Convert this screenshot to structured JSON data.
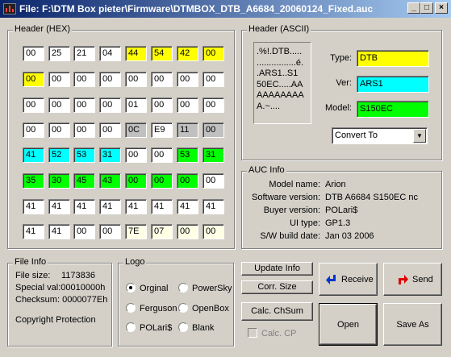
{
  "window": {
    "title": "File: F:\\DTM Box pieter\\Firmware\\DTMBOX_DTB_A6684_20060124_Fixed.auc",
    "minimize": "_",
    "maximize": "□",
    "close": "×"
  },
  "hex": {
    "title": "Header (HEX)",
    "rows": [
      [
        {
          "v": "00",
          "c": "w"
        },
        {
          "v": "25",
          "c": "w"
        },
        {
          "v": "21",
          "c": "w"
        },
        {
          "v": "04",
          "c": "w"
        },
        {
          "v": "44",
          "c": "y"
        },
        {
          "v": "54",
          "c": "y"
        },
        {
          "v": "42",
          "c": "y"
        },
        {
          "v": "00",
          "c": "y"
        }
      ],
      [
        {
          "v": "00",
          "c": "y"
        },
        {
          "v": "00",
          "c": "w"
        },
        {
          "v": "00",
          "c": "w"
        },
        {
          "v": "00",
          "c": "w"
        },
        {
          "v": "00",
          "c": "w"
        },
        {
          "v": "00",
          "c": "w"
        },
        {
          "v": "00",
          "c": "w"
        },
        {
          "v": "00",
          "c": "w"
        }
      ],
      [
        {
          "v": "00",
          "c": "w"
        },
        {
          "v": "00",
          "c": "w"
        },
        {
          "v": "00",
          "c": "w"
        },
        {
          "v": "00",
          "c": "w"
        },
        {
          "v": "01",
          "c": "w"
        },
        {
          "v": "00",
          "c": "w"
        },
        {
          "v": "00",
          "c": "w"
        },
        {
          "v": "00",
          "c": "w"
        }
      ],
      [
        {
          "v": "00",
          "c": "w"
        },
        {
          "v": "00",
          "c": "w"
        },
        {
          "v": "00",
          "c": "w"
        },
        {
          "v": "00",
          "c": "w"
        },
        {
          "v": "0C",
          "c": "s"
        },
        {
          "v": "E9",
          "c": "w"
        },
        {
          "v": "11",
          "c": "s"
        },
        {
          "v": "00",
          "c": "s"
        }
      ],
      [
        {
          "v": "41",
          "c": "c"
        },
        {
          "v": "52",
          "c": "c"
        },
        {
          "v": "53",
          "c": "c"
        },
        {
          "v": "31",
          "c": "c"
        },
        {
          "v": "00",
          "c": "w"
        },
        {
          "v": "00",
          "c": "w"
        },
        {
          "v": "53",
          "c": "g"
        },
        {
          "v": "31",
          "c": "g"
        }
      ],
      [
        {
          "v": "35",
          "c": "g"
        },
        {
          "v": "30",
          "c": "g"
        },
        {
          "v": "45",
          "c": "g"
        },
        {
          "v": "43",
          "c": "g"
        },
        {
          "v": "00",
          "c": "g"
        },
        {
          "v": "00",
          "c": "g"
        },
        {
          "v": "00",
          "c": "g"
        },
        {
          "v": "00",
          "c": "w"
        }
      ],
      [
        {
          "v": "41",
          "c": "w"
        },
        {
          "v": "41",
          "c": "w"
        },
        {
          "v": "41",
          "c": "w"
        },
        {
          "v": "41",
          "c": "w"
        },
        {
          "v": "41",
          "c": "w"
        },
        {
          "v": "41",
          "c": "w"
        },
        {
          "v": "41",
          "c": "w"
        },
        {
          "v": "41",
          "c": "w"
        }
      ],
      [
        {
          "v": "41",
          "c": "w"
        },
        {
          "v": "41",
          "c": "w"
        },
        {
          "v": "00",
          "c": "w"
        },
        {
          "v": "00",
          "c": "w"
        },
        {
          "v": "7E",
          "c": "l"
        },
        {
          "v": "07",
          "c": "l"
        },
        {
          "v": "00",
          "c": "l"
        },
        {
          "v": "00",
          "c": "l"
        }
      ]
    ]
  },
  "ascii": {
    "title": "Header (ASCII)",
    "lines": [
      ".%!.DTB.....",
      "................é.",
      ".ARS1..S1",
      "50EC.....AA",
      "AAAAAAAA",
      "A.~...."
    ],
    "type_label": "Type:",
    "type_value": "DTB",
    "ver_label": "Ver:",
    "ver_value": "ARS1",
    "model_label": "Model:",
    "model_value": "S150EC",
    "convert": "Convert To"
  },
  "auc": {
    "title": "AUC Info",
    "rows": [
      {
        "label": "Model name:",
        "value": "Arion"
      },
      {
        "label": "Software version:",
        "value": "DTB A6684 S150EC nc"
      },
      {
        "label": "Buyer version:",
        "value": "POLari$"
      },
      {
        "label": "UI type:",
        "value": "GP1.3"
      },
      {
        "label": "S/W build date:",
        "value": "Jan 03 2006"
      }
    ]
  },
  "fileinfo": {
    "title": "File Info",
    "size_label": "File size:",
    "size_value": "1173836",
    "special": "Special val:00010000h",
    "checksum": "Checksum: 0000077Eh",
    "copyright": "Copyright Protection"
  },
  "logo": {
    "title": "Logo",
    "options": [
      {
        "label": "Orginal",
        "selected": true
      },
      {
        "label": "PowerSky",
        "selected": false
      },
      {
        "label": "Ferguson",
        "selected": false
      },
      {
        "label": "OpenBox",
        "selected": false
      },
      {
        "label": "POLari$",
        "selected": false
      },
      {
        "label": "Blank",
        "selected": false
      }
    ]
  },
  "buttons": {
    "update_info": "Update Info",
    "corr_size": "Corr. Size",
    "calc_chsum": "Calc. ChSum",
    "calc_cp": "Calc. CP",
    "receive": "Receive",
    "send": "Send",
    "open": "Open",
    "save_as": "Save As"
  },
  "colors": {
    "yellow": "#ffff00",
    "cyan": "#00ffff",
    "green": "#00ff00",
    "receive_arrow": "#0033cc",
    "send_arrow": "#e00000"
  }
}
